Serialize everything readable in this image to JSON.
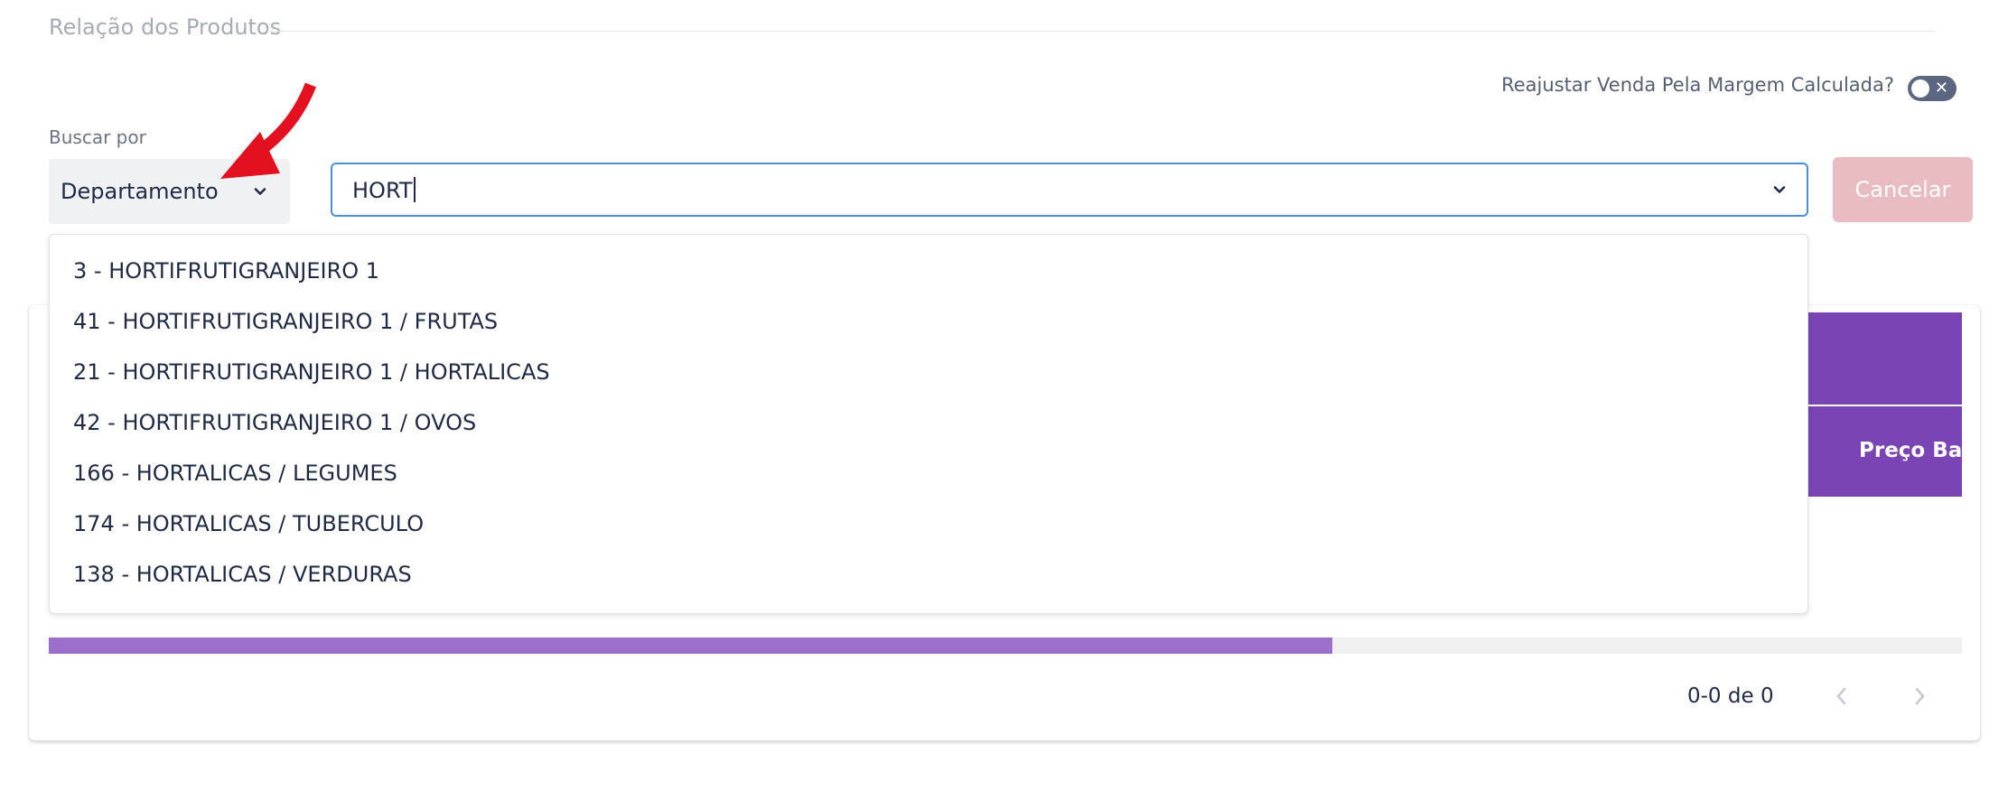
{
  "section": {
    "title": "Relação dos Produtos"
  },
  "toggle": {
    "label": "Reajustar Venda Pela Margem Calculada?",
    "state": "off",
    "icon": "x-icon"
  },
  "search_by": {
    "label": "Buscar por",
    "selected": "Departamento"
  },
  "search": {
    "value": "HORT"
  },
  "buttons": {
    "cancel_label": "Cancelar"
  },
  "dropdown": {
    "items": [
      "3 - HORTIFRUTIGRANJEIRO 1",
      "41 - HORTIFRUTIGRANJEIRO 1 / FRUTAS",
      "21 - HORTIFRUTIGRANJEIRO 1 / HORTALICAS",
      "42 - HORTIFRUTIGRANJEIRO 1 / OVOS",
      "166 - HORTALICAS / LEGUMES",
      "174 - HORTALICAS / TUBERCULO",
      "138 - HORTALICAS / VERDURAS"
    ]
  },
  "table": {
    "visible_column": "Preço Bas",
    "progress": 0.671
  },
  "pagination": {
    "text": "0-0 de 0"
  },
  "colors": {
    "header_purple": "#7b44b4",
    "progress_purple": "#9c6fca",
    "input_focus_blue": "#4a90d9",
    "cancel_disabled": "#e9bcc1",
    "annotation_red": "#e3101f"
  }
}
